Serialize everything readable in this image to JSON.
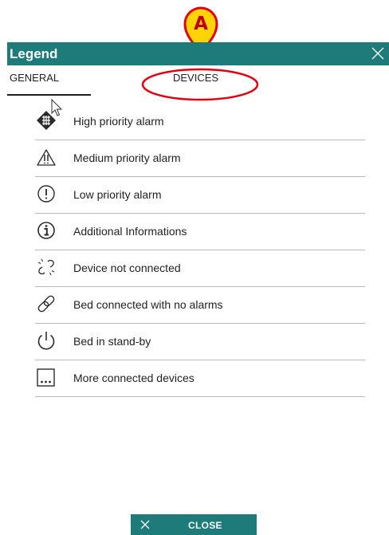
{
  "annotation": {
    "marker_letter": "A"
  },
  "dialog": {
    "title": "Legend",
    "tabs": [
      {
        "label": "GENERAL",
        "active": true
      },
      {
        "label": "DEVICES",
        "active": false
      }
    ],
    "legend_items": [
      {
        "icon": "high-priority-alarm-icon",
        "label": "High priority alarm"
      },
      {
        "icon": "medium-priority-alarm-icon",
        "label": "Medium priority alarm"
      },
      {
        "icon": "low-priority-alarm-icon",
        "label": "Low priority alarm"
      },
      {
        "icon": "info-icon",
        "label": "Additional Informations"
      },
      {
        "icon": "broken-link-icon",
        "label": "Device not connected"
      },
      {
        "icon": "link-icon",
        "label": "Bed connected with no alarms"
      },
      {
        "icon": "power-icon",
        "label": "Bed in stand-by"
      },
      {
        "icon": "more-devices-icon",
        "label": "More connected devices"
      }
    ],
    "close_button": {
      "label": "CLOSE"
    }
  },
  "colors": {
    "accent": "#1d7b7a",
    "annotation": "#e3000f",
    "marker_fill": "#ffd400"
  }
}
